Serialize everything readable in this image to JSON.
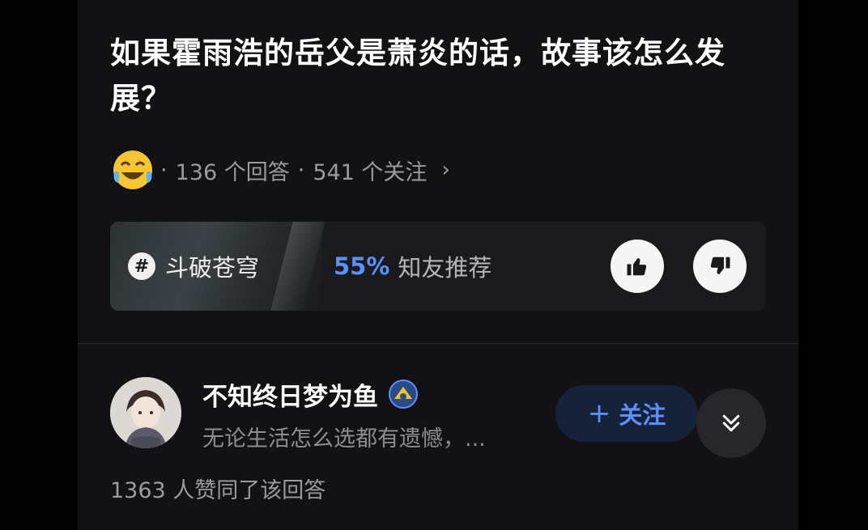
{
  "question": {
    "title": "如果霍雨浩的岳父是萧炎的话，故事该怎么发展？",
    "answer_count_text": "136 个回答",
    "follow_count_text": "541 个关注",
    "separator": "·",
    "more_icon": "chevron-right-icon"
  },
  "topic": {
    "tag_icon": "hash-icon",
    "tag_label": "斗破苍穹",
    "recommend_percent": "55%",
    "recommend_label": "知友推荐",
    "upvote_icon": "thumbs-up-icon",
    "downvote_icon": "thumbs-down-icon"
  },
  "answer": {
    "author_name": "不知终日梦为鱼",
    "author_bio": "无论生活怎么选都有遗憾，...",
    "follow_label": "关注",
    "follow_plus": "+",
    "likes_text": "1363 人赞同了该回答"
  },
  "colors": {
    "background": "#121214",
    "accent": "#5b8ff9",
    "text_primary": "#ffffff",
    "text_secondary": "#9a9aa0"
  }
}
